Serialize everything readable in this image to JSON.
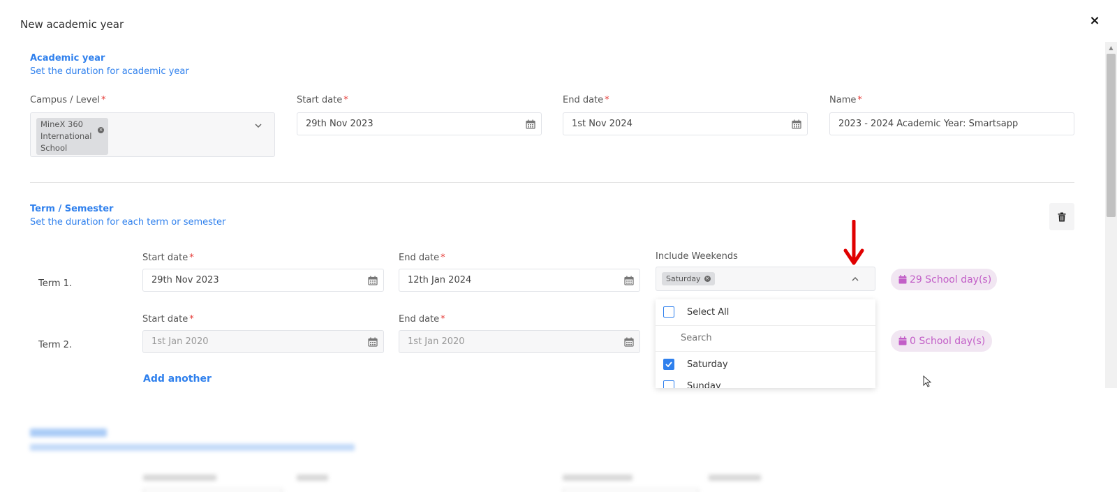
{
  "modal": {
    "title": "New academic year",
    "close": "×"
  },
  "academic_year": {
    "title": "Academic year",
    "subtitle": "Set the duration for academic year",
    "campus_label": "Campus / Level",
    "campus_chip": "MineX 360 International School",
    "start_label": "Start date",
    "start_value": "29th Nov 2023",
    "end_label": "End date",
    "end_value": "1st Nov 2024",
    "name_label": "Name",
    "name_value": "2023 - 2024 Academic Year: Smartsapp",
    "required_mark": "*"
  },
  "terms_section": {
    "title": "Term / Semester",
    "subtitle": "Set the duration for each term or semester",
    "terms": [
      {
        "label": "Term 1.",
        "start_label": "Start date",
        "start_value": "29th Nov 2023",
        "end_label": "End date",
        "end_value": "12th Jan 2024",
        "weekends_label": "Include Weekends",
        "weekend_chip": "Saturday",
        "days": "29 School day(s)"
      },
      {
        "label": "Term 2.",
        "start_label": "Start date",
        "start_value": "1st Jan 2020",
        "end_label": "End date",
        "end_value": "1st Jan 2020",
        "days": "0 School day(s)"
      }
    ],
    "add_another": "Add another"
  },
  "dropdown": {
    "select_all": "Select All",
    "search_placeholder": "Search",
    "options": [
      {
        "label": "Saturday",
        "checked": true
      },
      {
        "label": "Sunday",
        "checked": false
      }
    ]
  },
  "colors": {
    "accent": "#2f80ed",
    "required": "#e53935",
    "pill_bg": "#f1e6f2",
    "pill_text": "#c25ec7",
    "arrow": "#e00000"
  },
  "icons": [
    "close-icon",
    "chevron-down-icon",
    "chevron-up-icon",
    "calendar-icon",
    "trash-icon",
    "chip-remove-icon",
    "check-icon"
  ]
}
